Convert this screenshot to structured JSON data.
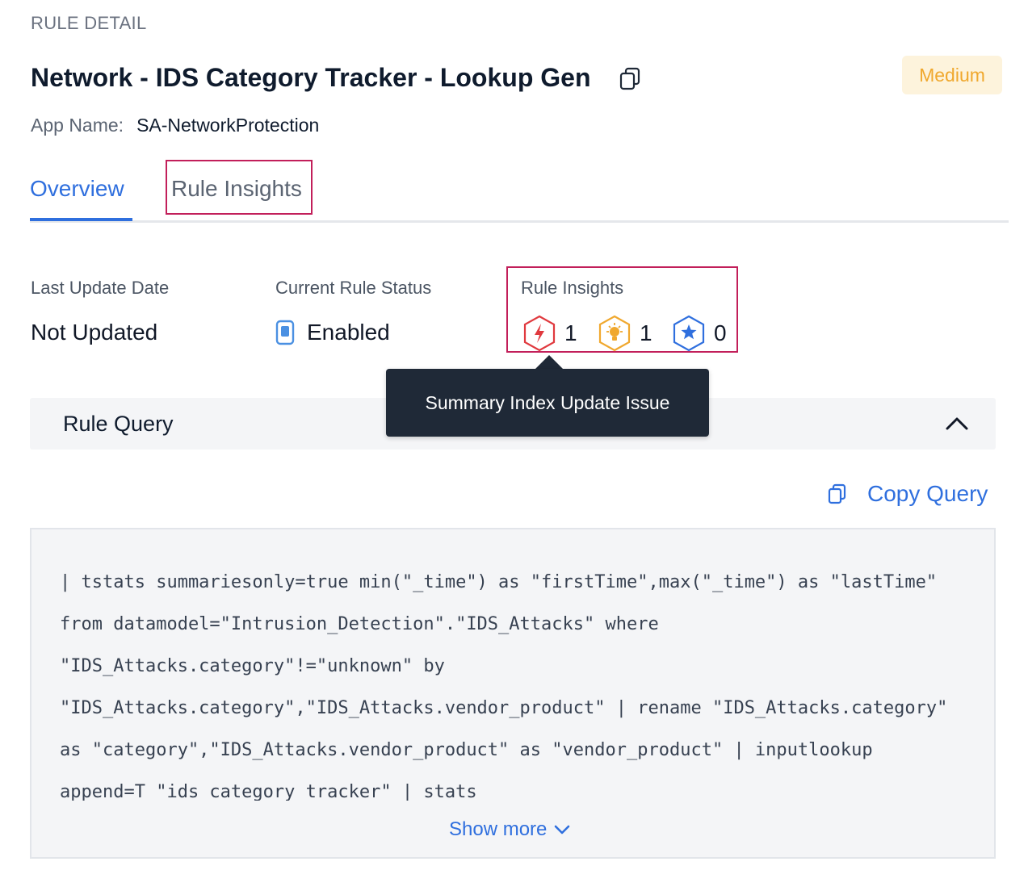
{
  "header": {
    "section_label": "RULE DETAIL",
    "rule_title": "Network - IDS Category Tracker - Lookup Gen",
    "severity": "Medium",
    "app_label": "App Name:",
    "app_name": "SA-NetworkProtection"
  },
  "tabs": [
    {
      "label": "Overview",
      "active": true
    },
    {
      "label": "Rule Insights",
      "active": false
    }
  ],
  "meta": {
    "last_update_label": "Last Update Date",
    "last_update_value": "Not Updated",
    "status_label": "Current Rule Status",
    "status_value": "Enabled",
    "insights_label": "Rule Insights",
    "insights": [
      {
        "icon": "bolt-hexagon-icon",
        "count": "1",
        "color": "#e0393e"
      },
      {
        "icon": "lightbulb-hexagon-icon",
        "count": "1",
        "color": "#f0a82e"
      },
      {
        "icon": "star-hexagon-icon",
        "count": "0",
        "color": "#2f6fde"
      }
    ]
  },
  "tooltip": {
    "text": "Summary Index Update Issue"
  },
  "query": {
    "title": "Rule Query",
    "copy_label": "Copy Query",
    "code": "| tstats summariesonly=true min(\"_time\") as \"firstTime\",max(\"_time\") as \"lastTime\" from datamodel=\"Intrusion_Detection\".\"IDS_Attacks\" where \"IDS_Attacks.category\"!=\"unknown\" by \"IDS_Attacks.category\",\"IDS_Attacks.vendor_product\" | rename \"IDS_Attacks.category\" as \"category\",\"IDS_Attacks.vendor_product\" as \"vendor_product\" | inputlookup append=T \"ids_category_tracker\" | stats",
    "show_more_label": "Show more"
  },
  "colors": {
    "accent": "#2f6fde",
    "highlight_border": "#c21f5a",
    "severity_text": "#f0a82e",
    "severity_bg": "#fdf3dc",
    "tooltip_bg": "#1f2937"
  }
}
